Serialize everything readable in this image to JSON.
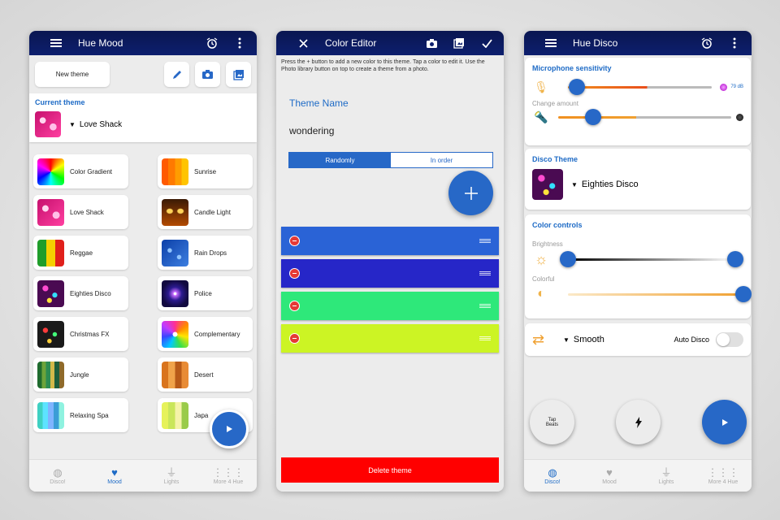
{
  "phone1": {
    "appbar": {
      "title": "Hue Mood",
      "menu_icon": "menu-icon",
      "alarm_icon": "alarm-icon",
      "more_icon": "more-vert-icon"
    },
    "new_theme_label": "New theme",
    "current_theme": {
      "label": "Current theme",
      "name": "Love Shack"
    },
    "themes": [
      {
        "name": "Color Gradient"
      },
      {
        "name": "Sunrise"
      },
      {
        "name": "Love Shack"
      },
      {
        "name": "Candle Light"
      },
      {
        "name": "Reggae"
      },
      {
        "name": "Rain Drops"
      },
      {
        "name": "Eighties Disco"
      },
      {
        "name": "Police"
      },
      {
        "name": "Christmas FX"
      },
      {
        "name": "Complementary"
      },
      {
        "name": "Jungle"
      },
      {
        "name": "Desert"
      },
      {
        "name": "Relaxing Spa"
      },
      {
        "name": "Japa"
      }
    ],
    "nav": [
      {
        "label": "Disco!",
        "icon": "disco-ball-icon"
      },
      {
        "label": "Mood",
        "icon": "heart-icon"
      },
      {
        "label": "Lights",
        "icon": "lamp-icon"
      },
      {
        "label": "More 4 Hue",
        "icon": "grid-icon"
      }
    ],
    "active_nav": "Mood"
  },
  "phone2": {
    "appbar": {
      "title": "Color Editor",
      "close_icon": "close-icon",
      "camera_icon": "camera-icon",
      "gallery_icon": "image-icon",
      "check_icon": "check-icon"
    },
    "help_text": "Press the + button to add a new color to this theme. Tap a color to edit it. Use the Photo library button on top to create a theme from a photo.",
    "theme_name_label": "Theme Name",
    "theme_name_value": "wondering",
    "order_options": [
      "Randomly",
      "In order"
    ],
    "selected_order": "Randomly",
    "colors": [
      "#2a63d6",
      "#2626c8",
      "#2ee87a",
      "#ccf424"
    ],
    "delete_label": "Delete theme",
    "accent": "#2768c7",
    "danger": "#ff0000"
  },
  "phone3": {
    "appbar": {
      "title": "Hue Disco",
      "menu_icon": "menu-icon",
      "alarm_icon": "alarm-icon",
      "more_icon": "more-vert-icon"
    },
    "mic_section": {
      "label": "Microphone sensitivity",
      "db_value": "79 dB",
      "change_amount_label": "Change amount",
      "mic_level": 0.06,
      "change_level": 0.2
    },
    "disco_theme": {
      "label": "Disco Theme",
      "name": "Eighties Disco"
    },
    "color_controls": {
      "label": "Color controls",
      "brightness_label": "Brightness",
      "colorful_label": "Colorful",
      "brightness_min": 0.0,
      "brightness_max": 1.0,
      "colorful_level": 1.0
    },
    "transition": {
      "mode": "Smooth",
      "auto_disco_label": "Auto Disco",
      "auto_disco_on": false
    },
    "tap_beats_label": "Tap Beats",
    "nav": [
      {
        "label": "Disco!",
        "icon": "disco-ball-icon"
      },
      {
        "label": "Mood",
        "icon": "heart-icon"
      },
      {
        "label": "Lights",
        "icon": "lamp-icon"
      },
      {
        "label": "More 4 Hue",
        "icon": "grid-icon"
      }
    ],
    "active_nav": "Disco!"
  }
}
